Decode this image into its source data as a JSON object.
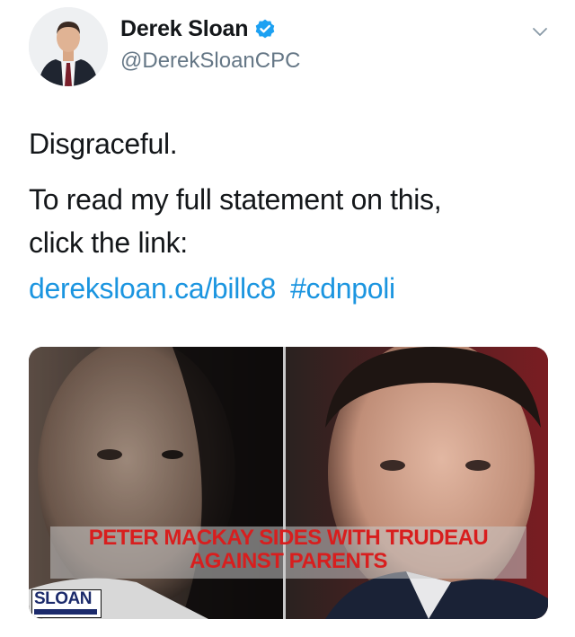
{
  "author": {
    "display_name": "Derek Sloan",
    "handle": "@DerekSloanCPC",
    "verified": true,
    "avatar_icon": "avatar-photo-icon"
  },
  "menu": {
    "icon": "chevron-down-icon"
  },
  "tweet": {
    "paragraph1": "Disgraceful.",
    "paragraph2_line1": "To read my full statement on this,",
    "paragraph2_line2": "click the link:",
    "link_text": "dereksloan.ca/billc8",
    "hashtag": "#cdnpoli"
  },
  "media": {
    "headline_line1": "PETER MACKAY SIDES WITH TRUDEAU",
    "headline_line2": "AGAINST PARENTS",
    "logo_text": "SLOAN",
    "headline_color": "#d81e1e"
  },
  "colors": {
    "link": "#1b95e0",
    "verified": "#1da1f2",
    "handle": "#657786"
  }
}
